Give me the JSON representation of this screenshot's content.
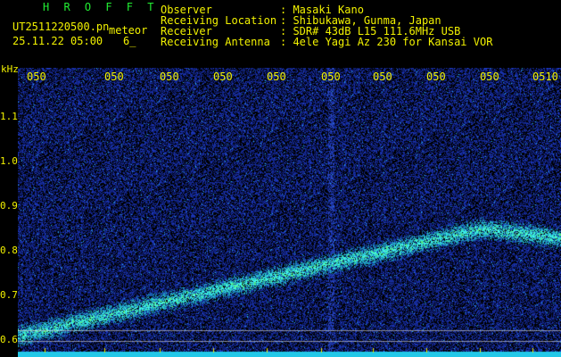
{
  "header": {
    "title": "H R O F F T",
    "filename": "UT2511220500.pn",
    "meteor_label": "meteor",
    "timestamp": "25.11.22 05:00",
    "count": "6_",
    "meta": [
      {
        "label": "Observer",
        "value": ": Masaki Kano"
      },
      {
        "label": "Receiving Location",
        "value": ": Shibukawa, Gunma, Japan"
      },
      {
        "label": "Receiver",
        "value": ": SDR# 43dB L15 111.6MHz USB"
      },
      {
        "label": "Receiving Antenna",
        "value": ": 4ele Yagi Az 230 for Kansai VOR"
      }
    ]
  },
  "axis": {
    "y_unit": "kHz",
    "y_ticks": [
      "1.1",
      "1.0",
      "0.9",
      "0.8",
      "0.7",
      "0.6"
    ],
    "x_ticks": [
      "050",
      "050",
      "050",
      "050",
      "050",
      "050",
      "050",
      "050",
      "050",
      "0510"
    ]
  },
  "colors": {
    "header_green": "#22ee33",
    "label_yellow": "#f2f200",
    "background": "#000000",
    "noise_blue": "#1a2a9a"
  }
}
